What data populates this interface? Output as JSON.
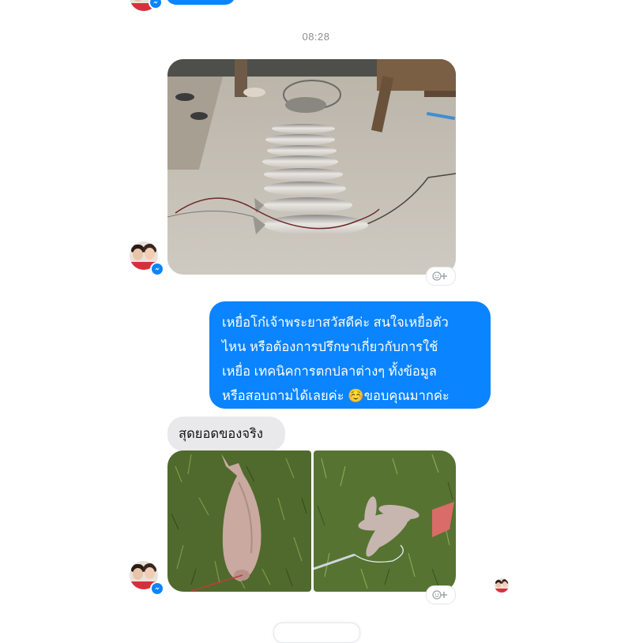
{
  "timestamp": "08:28",
  "outgoing_message": {
    "lines": [
      "เหยื่อโก๋เจ้าพระยาสวัสดีค่ะ สนใจเหยื่อตัว",
      "ไหน หรือต้องการปรึกษาเกี่ยวกับการใช้",
      "เหยื่อ เทคนิคการตกปลาต่างๆ ทั้งข้อมูล",
      "หรือสอบถามได้เลยค่ะ ☺️ขอบคุณมากค่ะ"
    ]
  },
  "incoming_message": {
    "text": "สุดยอดของจริง"
  },
  "icons": {
    "avatar": "couple-profile-avatar",
    "badge": "messenger-icon",
    "reaction": "add-reaction-icon"
  },
  "colors": {
    "outgoing_bubble": "#0a84ff",
    "incoming_bubble": "#e9e9eb",
    "messenger_badge": "#0a84ff"
  }
}
